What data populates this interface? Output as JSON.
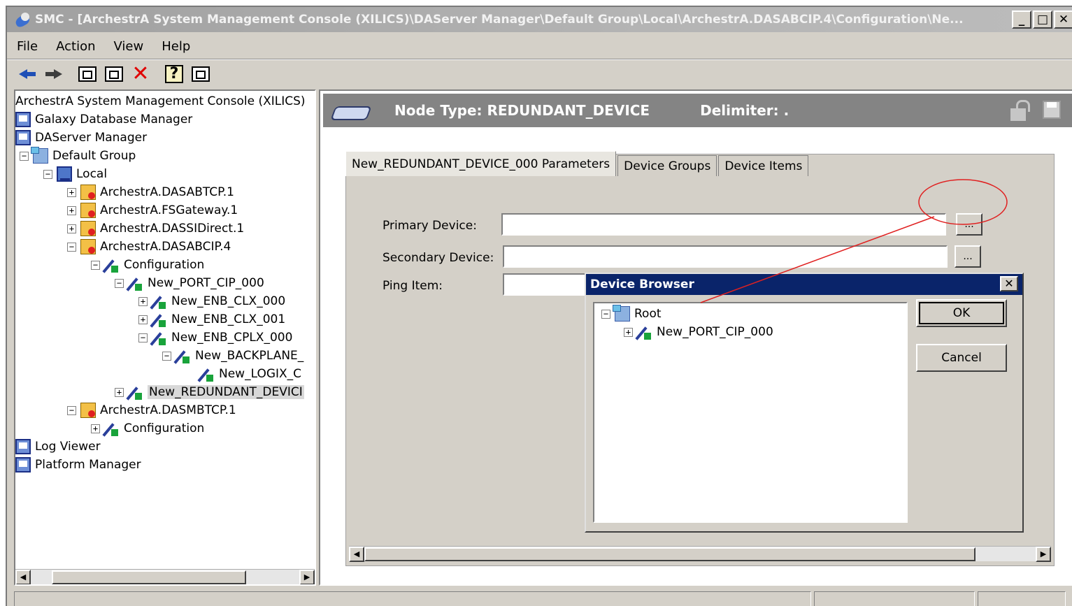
{
  "window": {
    "title": "SMC - [ArchestrA System Management Console (XILICS)\\DAServer Manager\\Default Group\\Local\\ArchestrA.DASABCIP.4\\Configuration\\Ne...",
    "min_glyph": "_",
    "max_glyph": "□",
    "close_glyph": "✕"
  },
  "menu": {
    "file": "File",
    "action": "Action",
    "view": "View",
    "help": "Help"
  },
  "toolbar": {
    "icons": [
      "back-arrow-icon",
      "forward-arrow-icon",
      "up-folder-icon",
      "show-hide-tree-icon",
      "delete-icon",
      "help-icon",
      "properties-icon"
    ],
    "delete_glyph": "✕",
    "help_glyph": "?"
  },
  "tree": {
    "root": "ArchestrA System Management Console (XILICS)",
    "galaxy_db": "Galaxy Database Manager",
    "daserver_manager": "DAServer Manager",
    "default_group": "Default Group",
    "local": "Local",
    "dasabtcp": "ArchestrA.DASABTCP.1",
    "fsgateway": "ArchestrA.FSGateway.1",
    "dassidirect": "ArchestrA.DASSIDirect.1",
    "dasabcip": "ArchestrA.DASABCIP.4",
    "configuration": "Configuration",
    "port_cip": "New_PORT_CIP_000",
    "enb_clx_000": "New_ENB_CLX_000",
    "enb_clx_001": "New_ENB_CLX_001",
    "enb_cplx_000": "New_ENB_CPLX_000",
    "backplane": "New_BACKPLANE_",
    "logix": "New_LOGIX_C",
    "redundant": "New_REDUNDANT_DEVICI",
    "dasmbtcp": "ArchestrA.DASMBTCP.1",
    "configuration2": "Configuration",
    "log_viewer": "Log Viewer",
    "platform_manager": "Platform Manager",
    "plus": "+",
    "minus": "−"
  },
  "node_header": {
    "node_type": "Node Type: REDUNDANT_DEVICE",
    "delimiter": "Delimiter: ."
  },
  "tabs": {
    "parameters": "New_REDUNDANT_DEVICE_000 Parameters",
    "device_groups": "Device Groups",
    "device_items": "Device Items"
  },
  "form": {
    "primary_label": "Primary Device:",
    "primary_value": "",
    "secondary_label": "Secondary Device:",
    "secondary_value": "",
    "ping_label": "Ping Item:",
    "ping_value": "",
    "browse_label": "..."
  },
  "dialog": {
    "title": "Device Browser",
    "close": "✕",
    "tree_root": "Root",
    "tree_child": "New_PORT_CIP_000",
    "ok": "OK",
    "cancel": "Cancel"
  },
  "scroll": {
    "left": "◀",
    "right": "▶"
  },
  "colors": {
    "title_bar": "#a0a0a0",
    "dialog_title": "#0a246a",
    "annotation": "#e02020"
  }
}
